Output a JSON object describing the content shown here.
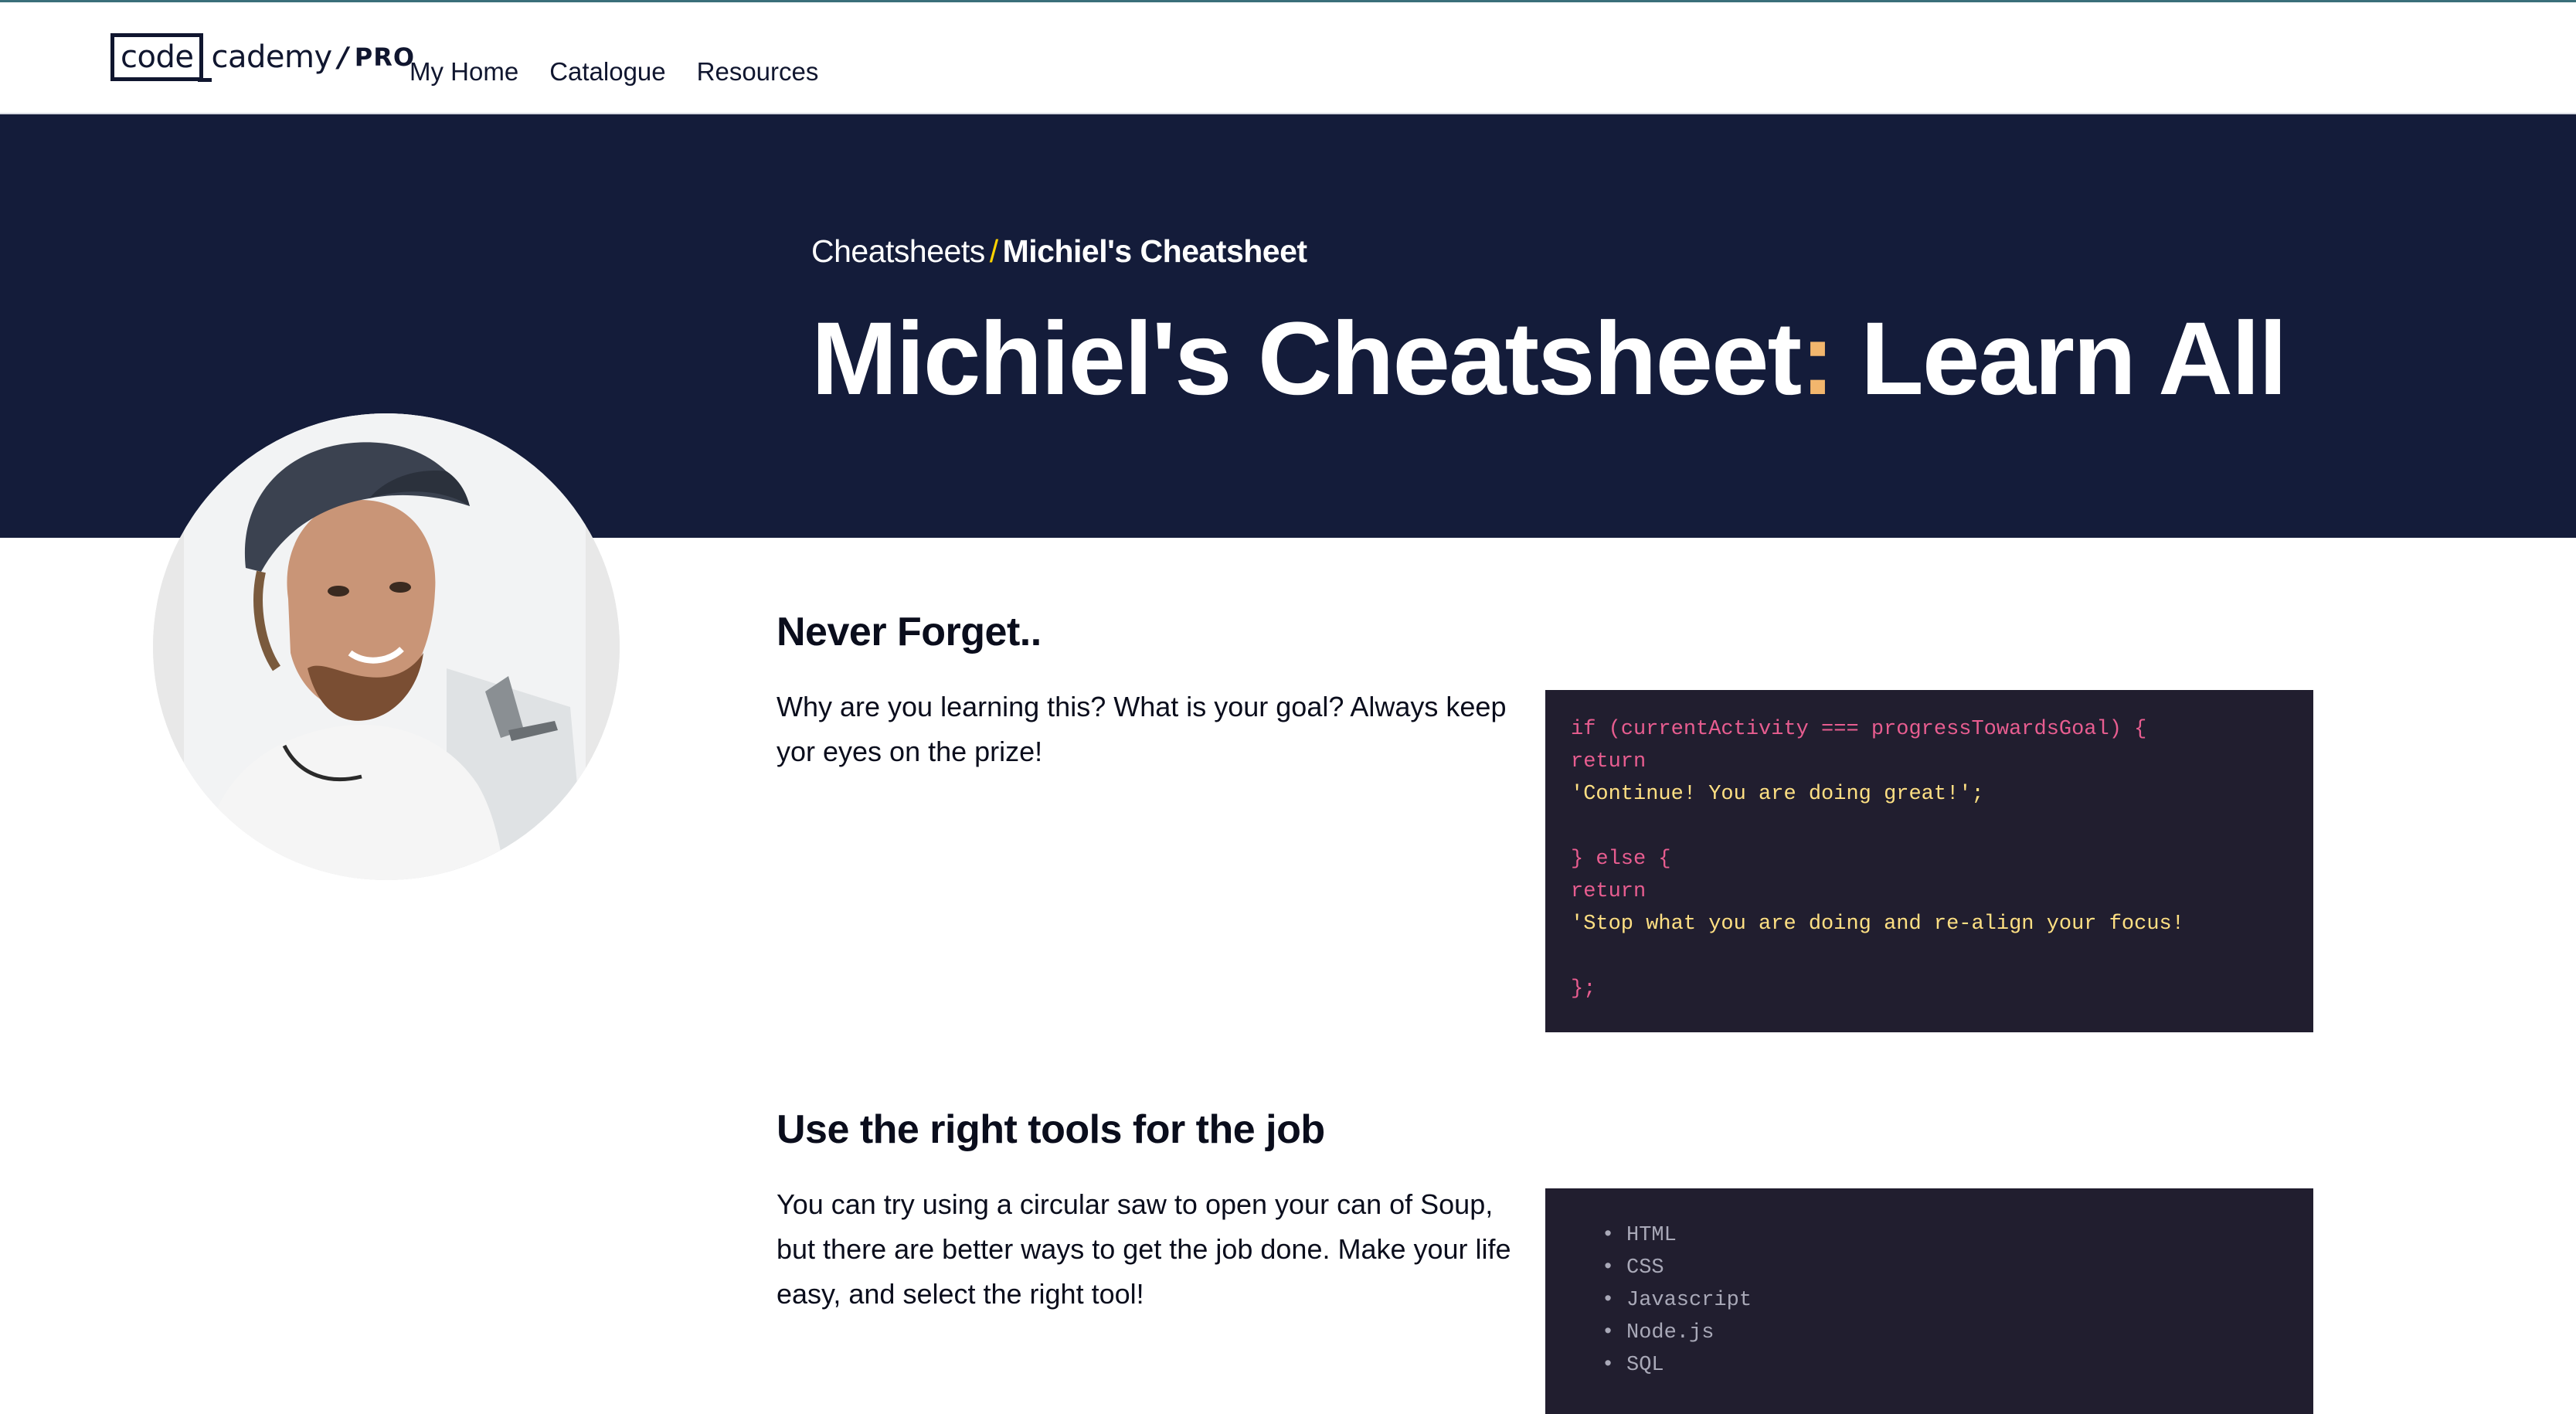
{
  "nav": {
    "logo_code": "code",
    "logo_rest": "cademy",
    "logo_sep": "/",
    "logo_pro": "PRO",
    "links": [
      "My Home",
      "Catalogue",
      "Resources"
    ]
  },
  "hero": {
    "breadcrumb_parent": "Cheatsheets",
    "breadcrumb_sep": "/",
    "breadcrumb_current": "Michiel's Cheatsheet",
    "title_main": "Michiel's Cheatsheet",
    "title_colon": ":",
    "title_sub": " Learn All"
  },
  "sections": [
    {
      "title": "Never Forget..",
      "text": "Why are you learning this? What is your goal? Always keep yor eyes on the prize!",
      "code_lines": [
        {
          "text": "if (currentActivity === progressTowardsGoal) {",
          "kind": "kw"
        },
        {
          "text": "return",
          "kind": "kw"
        },
        {
          "text": "'Continue! You are doing great!';",
          "kind": "str"
        },
        {
          "text": "",
          "kind": "kw"
        },
        {
          "text": "} else {",
          "kind": "kw"
        },
        {
          "text": "return",
          "kind": "kw"
        },
        {
          "text": "'Stop what you are doing and re-align your focus!",
          "kind": "str"
        },
        {
          "text": "",
          "kind": "kw"
        },
        {
          "text": "};",
          "kind": "kw"
        }
      ]
    },
    {
      "title": "Use the right tools for the job",
      "text": "You can try using a circular saw to open your can of Soup, but there are better ways to get the job done. Make your life easy, and select the right tool!",
      "list": [
        "HTML",
        "CSS",
        "Javascript",
        "Node.js",
        "SQL"
      ]
    }
  ],
  "colors": {
    "hero_bg": "#141c3a",
    "code_bg": "#211e2f",
    "keyword": "#e85d90",
    "string": "#ffe083",
    "accent_colon": "#f2b66d"
  }
}
